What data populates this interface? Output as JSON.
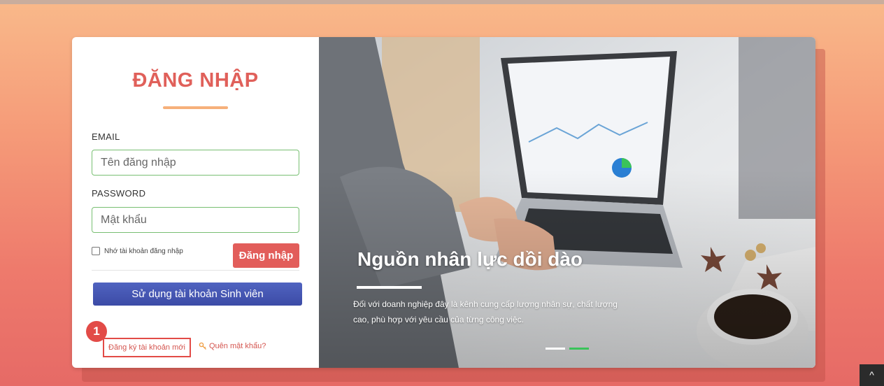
{
  "login": {
    "title": "ĐĂNG NHẬP",
    "email_label": "EMAIL",
    "email_placeholder": "Tên đăng nhập",
    "password_label": "PASSWORD",
    "password_placeholder": "Mật khẩu",
    "remember_label": "Nhớ tài khoản đăng nhập",
    "login_button": "Đăng nhập",
    "student_button": "Sử dụng tài khoản Sinh viên",
    "step_badge": "1",
    "register_link": "Đăng ký tài khoản mới",
    "forgot_link": "Quên mật khẩu?"
  },
  "hero": {
    "headline": "Nguồn nhân lực dồi dào",
    "description": "Đối với doanh nghiệp đây là kênh cung cấp lượng nhân sự, chất lượng cao, phù hợp với yêu cầu của từng công việc.",
    "slides_count": 2,
    "active_slide": 2
  },
  "icons": {
    "forgot": "key-icon",
    "scroll": "chevron-up-icon"
  },
  "colors": {
    "accent": "#e0605a",
    "student_button": "#4555b3",
    "active_dot": "#3ac35a"
  },
  "scroll_top": "^"
}
